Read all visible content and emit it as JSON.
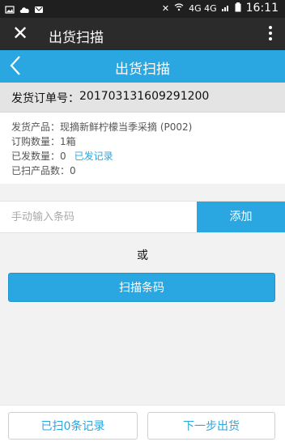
{
  "status_bar": {
    "network": "4G 4G",
    "time": "16:11",
    "icons": [
      "gallery-icon",
      "cloud-icon",
      "message-icon",
      "mute-icon",
      "wifi-icon",
      "signal-icon",
      "battery-icon"
    ]
  },
  "app_bar": {
    "title": "出货扫描",
    "close_icon": "close-icon",
    "more_icon": "more-icon"
  },
  "page_header": {
    "title": "出货扫描",
    "back_icon": "back-icon"
  },
  "order": {
    "label": "发货订单号：",
    "number": "201703131609291200"
  },
  "info": {
    "product_label": "发货产品：",
    "product_value": "现摘新鲜柠檬当季采摘 (P002)",
    "order_qty_label": "订购数量：",
    "order_qty_value": "1箱",
    "shipped_label": "已发数量：",
    "shipped_value": "0",
    "shipped_link": "已发记录",
    "scanned_label": "已扫产品数：",
    "scanned_value": "0"
  },
  "barcode": {
    "value": "",
    "placeholder": "手动输入条码",
    "add_label": "添加"
  },
  "or_text": "或",
  "scan_button_label": "扫描条码",
  "bottom": {
    "scanned_records_label": "已扫0条记录",
    "next_label": "下一步出货"
  },
  "colors": {
    "accent": "#2aa7e0",
    "app_bar": "#2b2b2b",
    "status_bar": "#1f1f1f"
  }
}
